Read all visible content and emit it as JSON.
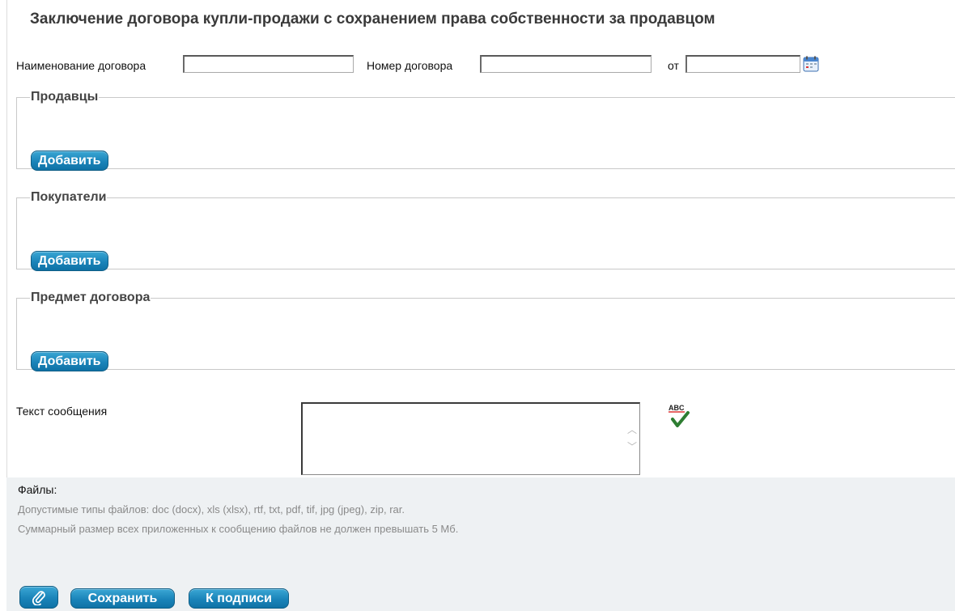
{
  "page": {
    "title": "Заключение договора купли-продажи с сохранением права собственности за продавцом"
  },
  "contract": {
    "name_label": "Наименование договора",
    "name_value": "",
    "number_label": "Номер договора",
    "number_value": "",
    "date_label": "от",
    "date_value": "",
    "calendar_icon": "calendar-icon"
  },
  "sections": {
    "sellers": {
      "legend": "Продавцы",
      "add_label": "Добавить"
    },
    "buyers": {
      "legend": "Покупатели",
      "add_label": "Добавить"
    },
    "subject": {
      "legend": "Предмет договора",
      "add_label": "Добавить"
    }
  },
  "message": {
    "label": "Текст сообщения",
    "value": "",
    "spellcheck_icon": "spellcheck-icon",
    "spellcheck_text": "ABC"
  },
  "files": {
    "title": "Файлы:",
    "allowed_types": "Допустимые типы файлов: doc (docx), xls (xlsx), rtf, txt, pdf, tif, jpg (jpeg), zip, rar.",
    "size_limit": "Суммарный размер всех приложенных к сообщению файлов не должен превышать 5 Мб."
  },
  "actions": {
    "attach_icon": "paperclip-icon",
    "save_label": "Сохранить",
    "sign_label": "К подписи"
  },
  "colors": {
    "button": "#1a84b9",
    "button_border": "#0f5e86",
    "files_panel_bg": "#eef1f3",
    "title": "#3a3a3a"
  }
}
